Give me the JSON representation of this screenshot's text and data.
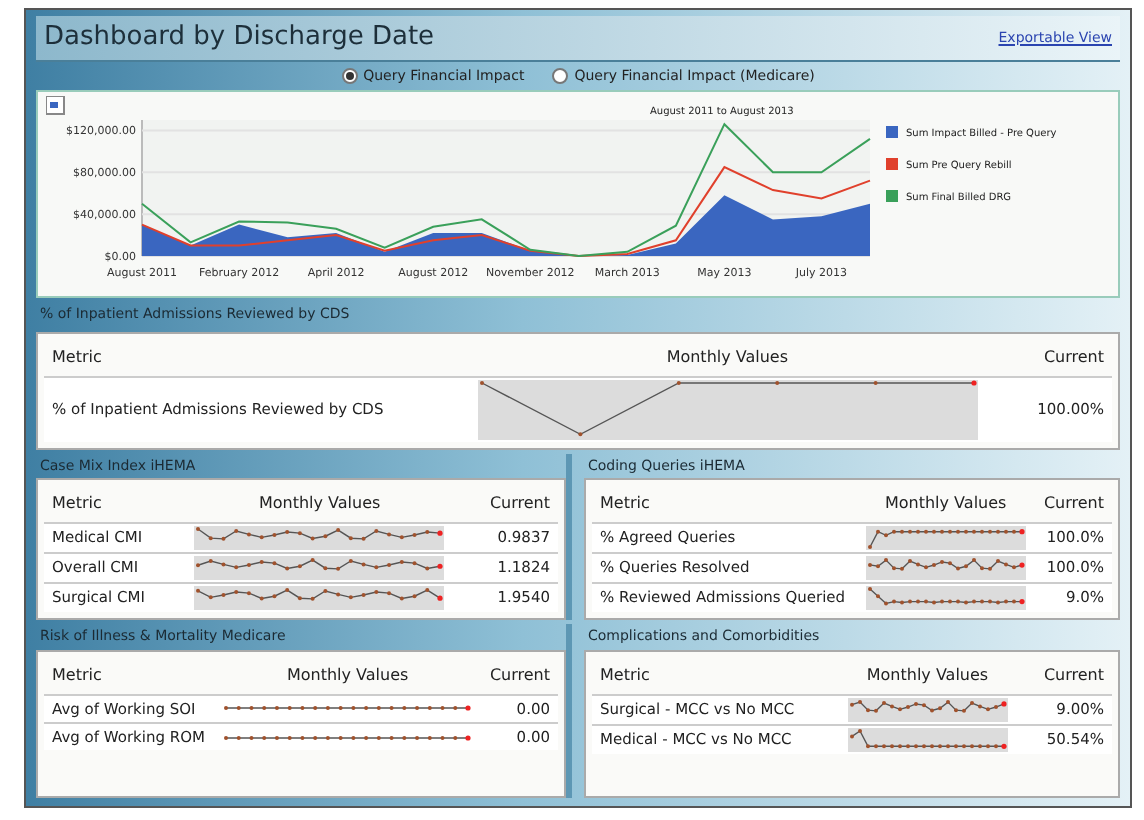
{
  "header": {
    "title": "Dashboard by Discharge Date",
    "link": "Exportable View"
  },
  "options": [
    {
      "label": "Query Financial Impact",
      "selected": true
    },
    {
      "label": "Query Financial Impact (Medicare)",
      "selected": false
    }
  ],
  "chart": {
    "chart_data": {
      "type": "line",
      "grid": true,
      "legend": "right",
      "categories": [
        "August 2011",
        null,
        "February 2012",
        null,
        "April 2012",
        null,
        "August 2012",
        null,
        "November 2012",
        null,
        "March 2013",
        null,
        "May 2013",
        null,
        "July 2013",
        null
      ],
      "yticks": [
        {
          "value": 0,
          "label": "$0.00"
        },
        {
          "value": 40000,
          "label": "$40,000.00"
        },
        {
          "value": 80000,
          "label": "$80,000.00"
        },
        {
          "value": 120000,
          "label": "$120,000.00"
        }
      ],
      "ylim": [
        0,
        130000
      ],
      "series": [
        {
          "name": "Sum Impact Billed - Pre Query",
          "color": "#3a66c0",
          "type": "area",
          "values": [
            30000,
            10000,
            30000,
            18000,
            22000,
            4000,
            22000,
            22000,
            5000,
            0,
            1000,
            12000,
            58000,
            35000,
            38000,
            50000
          ]
        },
        {
          "name": "Sum Pre Query Rebill",
          "color": "#e0402c",
          "type": "line",
          "values": [
            30000,
            10000,
            10000,
            15000,
            20000,
            5000,
            15000,
            20000,
            5000,
            0,
            2000,
            15000,
            85000,
            63000,
            55000,
            72000
          ]
        },
        {
          "name": "Sum Final Billed DRG",
          "color": "#3aa05a",
          "type": "line",
          "values": [
            50000,
            13000,
            33000,
            32000,
            26000,
            8000,
            28000,
            35000,
            6000,
            0,
            4000,
            29000,
            126000,
            80000,
            80000,
            112000
          ]
        }
      ],
      "annotations": [
        "August 2011 to August 2013"
      ]
    }
  },
  "panels": [
    {
      "title": "% of Inpatient Admissions Reviewed by CDS",
      "columns": [
        "Metric",
        "Monthly Values",
        "Current"
      ],
      "rows": [
        {
          "metric": "% of Inpatient Admissions Reviewed by CDS",
          "current": "100.00%"
        }
      ]
    },
    {
      "title": "Case Mix Index iHEMA",
      "columns": [
        "Metric",
        "Monthly Values",
        "Current"
      ],
      "rows": [
        {
          "metric": "Medical CMI",
          "current": "0.9837"
        },
        {
          "metric": "Overall CMI",
          "current": "1.1824"
        },
        {
          "metric": "Surgical CMI",
          "current": "1.9540"
        }
      ]
    },
    {
      "title": "Coding Queries iHEMA",
      "columns": [
        "Metric",
        "Monthly Values",
        "Current"
      ],
      "rows": [
        {
          "metric": "% Agreed Queries",
          "current": "100.0%"
        },
        {
          "metric": "% Queries Resolved",
          "current": "100.0%"
        },
        {
          "metric": "% Reviewed Admissions Queried",
          "current": "9.0%"
        }
      ]
    },
    {
      "title": "Risk of Illness & Mortality Medicare",
      "columns": [
        "Metric",
        "Monthly Values",
        "Current"
      ],
      "rows": [
        {
          "metric": "Avg of Working SOI",
          "current": "0.00"
        },
        {
          "metric": "Avg of Working ROM",
          "current": "0.00"
        }
      ]
    },
    {
      "title": "Complications and Comorbidities",
      "columns": [
        "Metric",
        "Monthly Values",
        "Current"
      ],
      "rows": [
        {
          "metric": "Surgical - MCC vs No MCC",
          "current": "9.00%"
        },
        {
          "metric": "Medical - MCC vs No MCC",
          "current": "50.54%"
        }
      ]
    }
  ]
}
